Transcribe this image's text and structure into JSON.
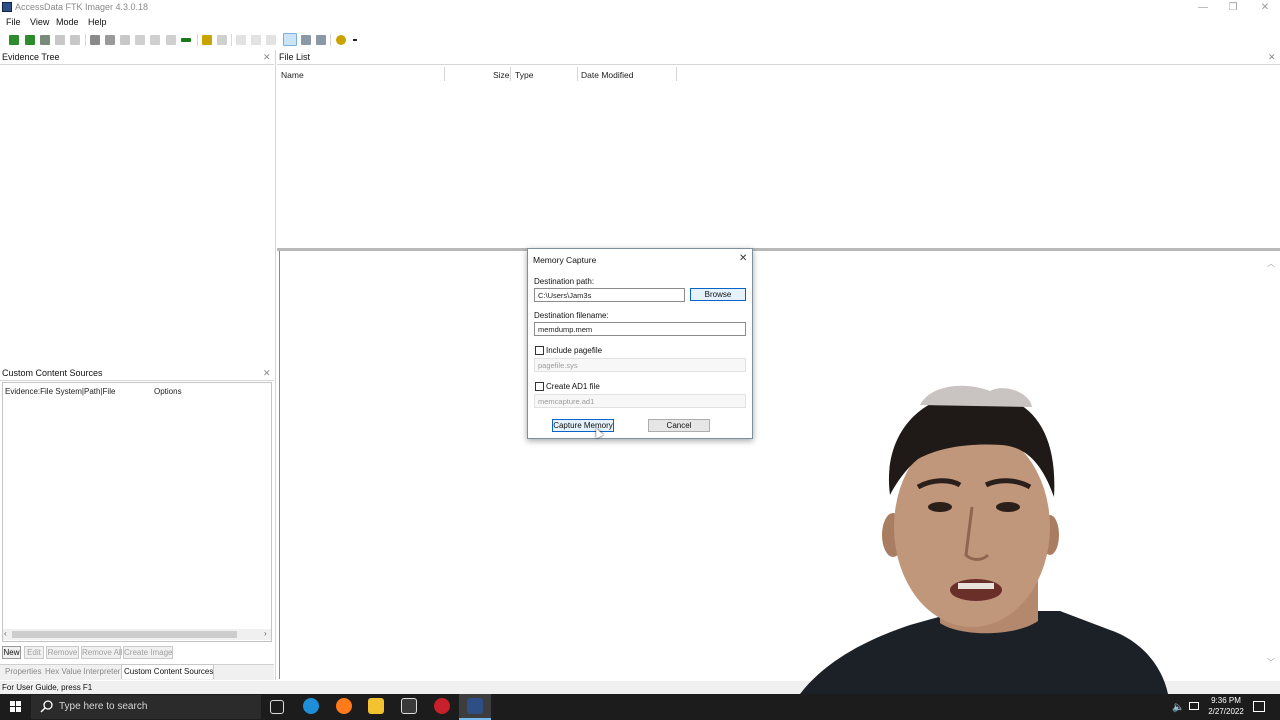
{
  "window": {
    "title": "AccessData FTK Imager 4.3.0.18",
    "controls": [
      "—",
      "❐",
      "✕"
    ]
  },
  "menu": [
    "File",
    "View",
    "Mode",
    "Help"
  ],
  "evidence_tree": {
    "title": "Evidence Tree",
    "close": "✕"
  },
  "file_list": {
    "title": "File List",
    "close": "✕",
    "columns": [
      "Name",
      "Size",
      "Type",
      "Date Modified"
    ]
  },
  "content_sources": {
    "title": "Custom Content Sources",
    "close": "✕",
    "columns": [
      "Evidence:File System|Path|File",
      "Options"
    ],
    "buttons": [
      "New",
      "Edit",
      "Remove",
      "Remove All",
      "Create Image"
    ],
    "tabs": [
      "Properties",
      "Hex Value Interpreter",
      "Custom Content Sources"
    ]
  },
  "dialog": {
    "title": "Memory Capture",
    "close": "✕",
    "dest_path_label": "Destination path:",
    "dest_path_value": "C:\\Users\\Jam3s",
    "browse_label": "Browse",
    "dest_filename_label": "Destination filename:",
    "dest_filename_value": "memdump.mem",
    "include_pagefile_label": "Include pagefile",
    "pagefile_value": "pagefile.sys",
    "create_ad1_label": "Create AD1 file",
    "ad1_value": "memcapture.ad1",
    "capture_label": "Capture Memory",
    "cancel_label": "Cancel"
  },
  "status": {
    "text": "For User Guide, press F1"
  },
  "taskbar": {
    "search_placeholder": "Type here to search",
    "time": "9:36 PM",
    "date": "2/27/2022"
  },
  "colors": {
    "taskbar": "#1c1c1c",
    "focus_blue": "#0a64c8",
    "toolbar_green": "#2e8b2e",
    "toolbar_yellow": "#c9a400"
  }
}
